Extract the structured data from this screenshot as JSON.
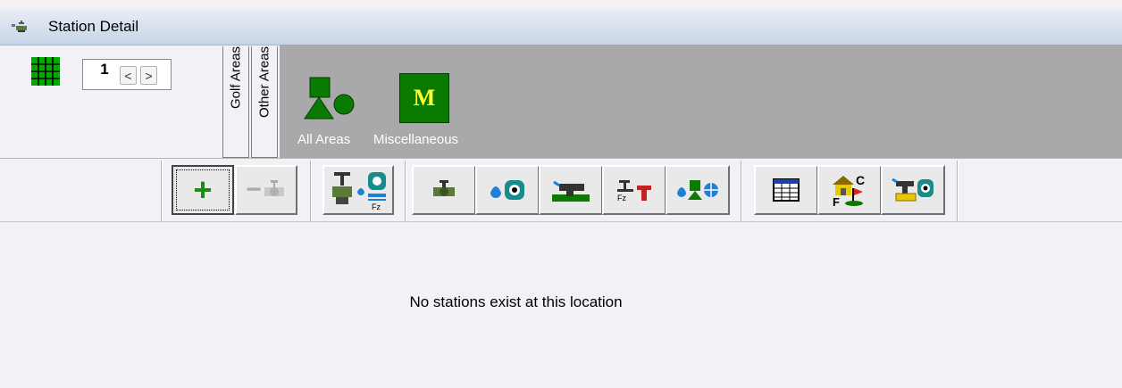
{
  "window": {
    "title": "Station Detail",
    "icon": "sprinkler-valve-icon"
  },
  "navigator": {
    "page": "1",
    "prev_glyph": "<",
    "next_glyph": ">",
    "grid_icon": "station-grid-icon"
  },
  "area_tabs": [
    {
      "label": "Golf Areas"
    },
    {
      "label": "Other Areas"
    }
  ],
  "areas": [
    {
      "label": "All Areas",
      "icon": "shapes-icon"
    },
    {
      "label": "Miscellaneous",
      "icon_text": "M"
    }
  ],
  "toolbar": {
    "groups": [
      [
        "add-station",
        "remove-station"
      ],
      [
        "station-flow-settings"
      ],
      [
        "valve",
        "water-meter",
        "pipe",
        "flow-zone",
        "water-map"
      ],
      [
        "spreadsheet",
        "course-features",
        "pipe-meter"
      ]
    ]
  },
  "colors": {
    "accent_green": "#0a7a00",
    "panel_grey": "#a9a8aa",
    "label_yellow": "#ffff33"
  },
  "main": {
    "empty_message": "No stations exist at this location"
  }
}
